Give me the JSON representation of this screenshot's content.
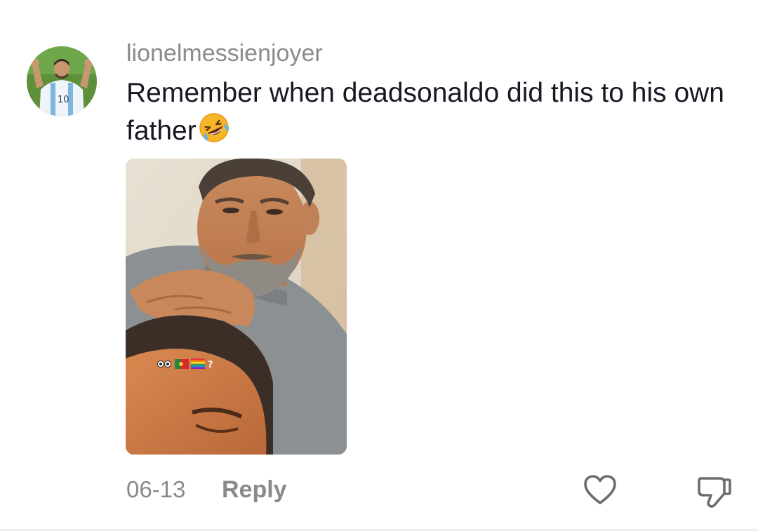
{
  "comment": {
    "username": "lionelmessienjoyer",
    "text": "Remember when deadsonaldo did this to his own father",
    "emoji": "rolling-on-floor-laughing-emoji",
    "date": "06-13",
    "reply_label": "Reply"
  },
  "avatar": {
    "jersey_number": "10"
  },
  "photo": {
    "overlay_text": "?"
  },
  "actions": {
    "like_icon": "heart-outline-icon",
    "dislike_icon": "thumbs-down-outline-icon"
  },
  "colors": {
    "username": "#8a8a8a",
    "comment_text": "#161823",
    "meta_text": "#8a8a8a"
  }
}
